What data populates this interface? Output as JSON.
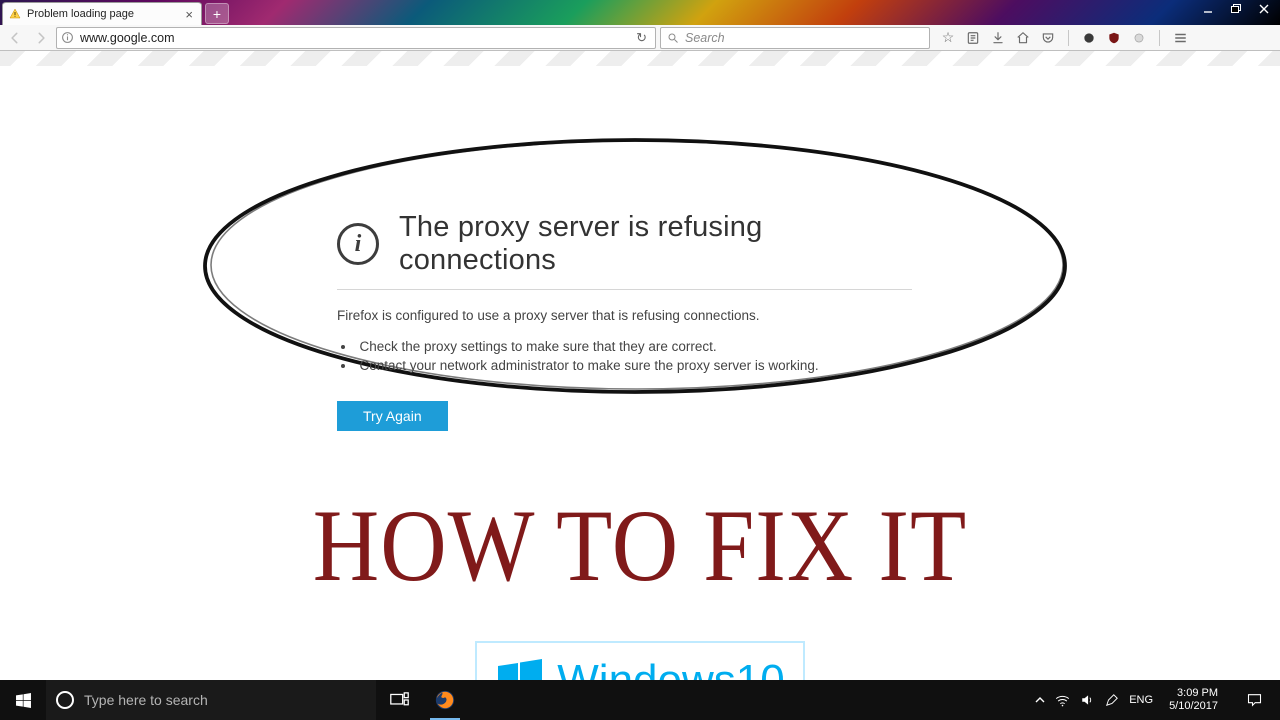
{
  "browser": {
    "tab_title": "Problem loading page",
    "url": "www.google.com",
    "search_placeholder": "Search"
  },
  "error": {
    "title": "The proxy server is refusing connections",
    "description": "Firefox is configured to use a proxy server that is refusing connections.",
    "bullets": [
      "Check the proxy settings to make sure that they are correct.",
      "Contact your network administrator to make sure the proxy server is working."
    ],
    "try_again": "Try Again"
  },
  "caption": "HOW TO FIX IT",
  "win10": {
    "brand": "Windows",
    "ver": "10"
  },
  "taskbar": {
    "search_placeholder": "Type here to search",
    "lang": "ENG",
    "time": "3:09 PM",
    "date": "5/10/2017"
  }
}
